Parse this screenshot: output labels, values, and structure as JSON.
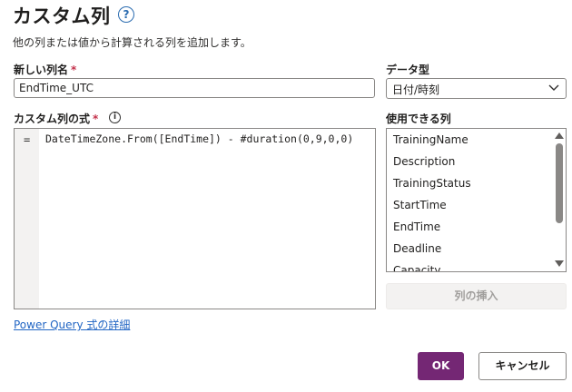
{
  "dialog": {
    "title": "カスタム列",
    "subtitle": "他の列または値から計算される列を追加します。"
  },
  "name_field": {
    "label": "新しい列名",
    "required_mark": "*",
    "value": "EndTime_UTC"
  },
  "formula_field": {
    "label": "カスタム列の式",
    "required_mark": "*",
    "prefix": "=",
    "formula": "DateTimeZone.From([EndTime]) - #duration(0,9,0,0)"
  },
  "learn_more_link": "Power Query 式の詳細",
  "data_type": {
    "label": "データ型",
    "selected": "日付/時刻"
  },
  "available_columns": {
    "label": "使用できる列",
    "items": [
      "TrainingName",
      "Description",
      "TrainingStatus",
      "StartTime",
      "EndTime",
      "Deadline",
      "Capacity"
    ],
    "insert_button": "列の挿入"
  },
  "buttons": {
    "ok": "OK",
    "cancel": "キャンセル"
  },
  "icons": {
    "help": "help-circle-icon",
    "info": "info-circle-icon",
    "dropdown": "chevron-down-icon"
  },
  "colors": {
    "primary": "#742774",
    "link": "#2266c4",
    "required": "#c4314b"
  }
}
